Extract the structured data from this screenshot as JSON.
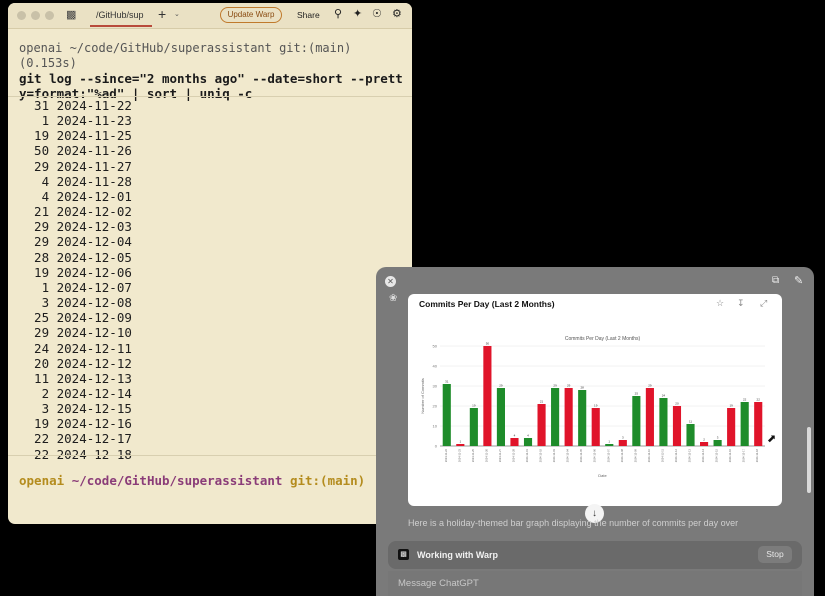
{
  "terminal": {
    "tab_title": "/GitHub/sup",
    "update_button": "Update Warp",
    "share_button": "Share",
    "prompt_line": "openai ~/code/GitHub/superassistant git:(main) (0.153s)",
    "command": "git log --since=\"2 months ago\" --date=short --pretty=format:\"%ad\" | sort | uniq -c",
    "output_lines": [
      "  31 2024-11-22",
      "   1 2024-11-23",
      "  19 2024-11-25",
      "  50 2024-11-26",
      "  29 2024-11-27",
      "   4 2024-11-28",
      "   4 2024-12-01",
      "  21 2024-12-02",
      "  29 2024-12-03",
      "  29 2024-12-04",
      "  28 2024-12-05",
      "  19 2024-12-06",
      "   1 2024-12-07",
      "   3 2024-12-08",
      "  25 2024-12-09",
      "  29 2024-12-10",
      "  24 2024-12-11",
      "  20 2024-12-12",
      "  11 2024-12-13",
      "   2 2024-12-14",
      "   3 2024-12-15",
      "  19 2024-12-16",
      "  22 2024-12-17",
      "  22 2024-12-18"
    ],
    "prompt_user": "openai",
    "prompt_path": "~/code/GitHub/superassistant",
    "prompt_git": "git:(main)"
  },
  "chat": {
    "chart_card_title": "Commits Per Day (Last 2 Months)",
    "message_text": "Here is a holiday-themed bar graph displaying the number of commits per day over",
    "working_label": "Working with Warp",
    "stop_button": "Stop",
    "input_placeholder": "Message ChatGPT"
  },
  "colors": {
    "terminal_bg": "#f1e9cd",
    "bar_red": "#e0142a",
    "bar_green": "#1e8c2a",
    "accent": "#b84a3a"
  },
  "chart_data": {
    "type": "bar",
    "title": "Commits Per Day (Last 2 Months)",
    "xlabel": "Date",
    "ylabel": "Number of Commits",
    "ylim": [
      0,
      50
    ],
    "grid": true,
    "colors_alternate": [
      "green",
      "red"
    ],
    "categories": [
      "2024-11-22",
      "2024-11-23",
      "2024-11-25",
      "2024-11-26",
      "2024-11-27",
      "2024-11-28",
      "2024-12-01",
      "2024-12-02",
      "2024-12-03",
      "2024-12-04",
      "2024-12-05",
      "2024-12-06",
      "2024-12-07",
      "2024-12-08",
      "2024-12-09",
      "2024-12-10",
      "2024-12-11",
      "2024-12-12",
      "2024-12-13",
      "2024-12-14",
      "2024-12-15",
      "2024-12-16",
      "2024-12-17",
      "2024-12-18"
    ],
    "values": [
      31,
      1,
      19,
      50,
      29,
      4,
      4,
      21,
      29,
      29,
      28,
      19,
      1,
      3,
      25,
      29,
      24,
      20,
      11,
      2,
      3,
      19,
      22,
      22
    ]
  }
}
